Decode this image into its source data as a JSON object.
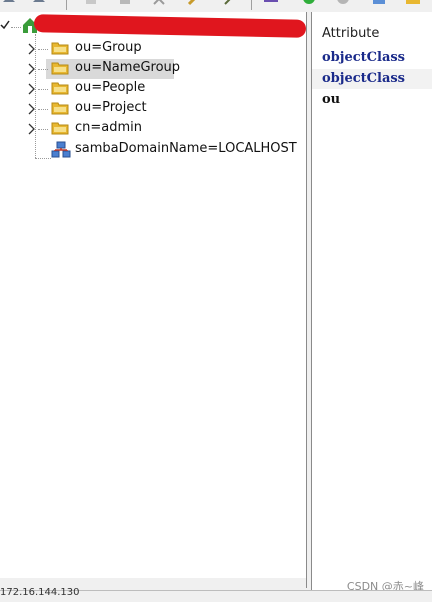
{
  "toolbar": {
    "icons": [
      "back-icon",
      "forward-icon",
      "doc-icon",
      "save-icon",
      "cut-icon",
      "edit-icon",
      "arrow-icon",
      "user-icon",
      "green-check-icon",
      "gray-circle-icon",
      "refresh-icon",
      "folder-icon"
    ]
  },
  "tree": {
    "root_label": "",
    "items": [
      {
        "label": "ou=Group",
        "icon": "folder-icon",
        "expandable": true
      },
      {
        "label": "ou=NameGroup",
        "icon": "folder-icon",
        "expandable": true,
        "selected": true
      },
      {
        "label": "ou=People",
        "icon": "folder-icon",
        "expandable": true
      },
      {
        "label": "ou=Project",
        "icon": "folder-icon",
        "expandable": true
      },
      {
        "label": "cn=admin",
        "icon": "folder-icon",
        "expandable": true
      },
      {
        "label": "sambaDomainName=LOCALHOST",
        "icon": "network-domain-icon",
        "expandable": false
      }
    ]
  },
  "attributes": {
    "header": "Attribute",
    "rows": [
      {
        "label": "objectClass",
        "color": "#1a2a8a"
      },
      {
        "label": "objectClass",
        "color": "#1a2a8a",
        "highlighted": true
      },
      {
        "label": "ou",
        "color": "#111111"
      }
    ]
  },
  "status": {
    "text": "172.16.144.130"
  },
  "watermark": {
    "text": "CSDN @赤~峰"
  },
  "colors": {
    "selection": "#d9d9d9",
    "folder": "#e8b730",
    "redaction": "#e0161e",
    "attr_blue": "#1a2a8a"
  }
}
